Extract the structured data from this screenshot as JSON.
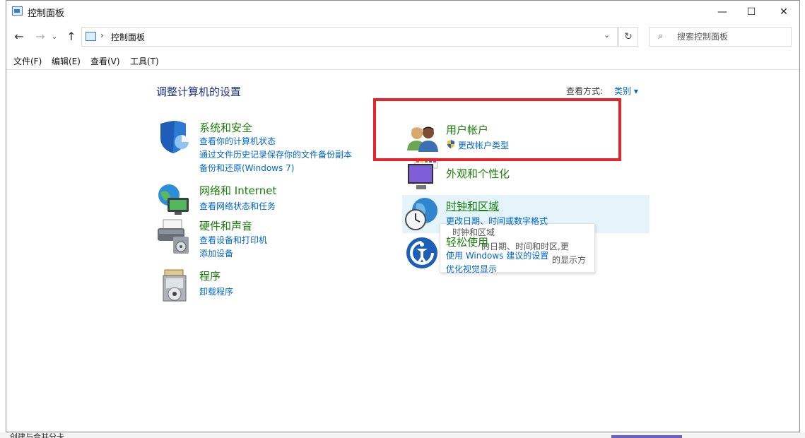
{
  "window": {
    "title": "控制面板",
    "minimize_glyph": "—",
    "maximize_glyph": "☐",
    "close_glyph": "✕"
  },
  "nav": {
    "back_glyph": "←",
    "forward_glyph": "→",
    "recent_glyph": "⌄",
    "up_glyph": "↑"
  },
  "address": {
    "separator": "›",
    "path": "控制面板",
    "dropdown_glyph": "⌄",
    "refresh_glyph": "↻"
  },
  "search": {
    "placeholder": "搜索控制面板",
    "icon_glyph": "⌕"
  },
  "menu": [
    "文件(F)",
    "编辑(E)",
    "查看(V)",
    "工具(T)"
  ],
  "heading": "调整计算机的设置",
  "view": {
    "label": "查看方式:",
    "value": "类别 ▾"
  },
  "categories": {
    "system": {
      "title": "系统和安全",
      "links": [
        "查看你的计算机状态",
        "通过文件历史记录保存你的文件备份副本",
        "备份和还原(Windows 7)"
      ]
    },
    "network": {
      "title": "网络和 Internet",
      "links": [
        "查看网络状态和任务"
      ]
    },
    "hardware": {
      "title": "硬件和声音",
      "links": [
        "查看设备和打印机",
        "添加设备"
      ]
    },
    "programs": {
      "title": "程序",
      "links": [
        "卸载程序"
      ]
    },
    "users": {
      "title": "用户帐户",
      "links": [
        "更改帐户类型"
      ]
    },
    "appearance": {
      "title": "外观和个性化",
      "links": []
    },
    "clock": {
      "title": "时钟和区域",
      "links": [
        "更改日期、时间或数字格式"
      ]
    },
    "ease": {
      "title": "轻松使用",
      "links": [
        "使用 Windows 建议的设置",
        "优化视觉显示"
      ]
    }
  },
  "tooltip": {
    "line1": "时钟和区域",
    "line2": "的日期、时间和时区,更",
    "line3": "的显示方"
  },
  "background": {
    "bottom_text": "创建与合并分卡"
  },
  "colors": {
    "accent_link": "#0066cc",
    "category_green": "#1a7f0a",
    "heading_blue": "#1e3287",
    "highlight_red": "#e8232a",
    "hover": "#e5f3fb"
  }
}
